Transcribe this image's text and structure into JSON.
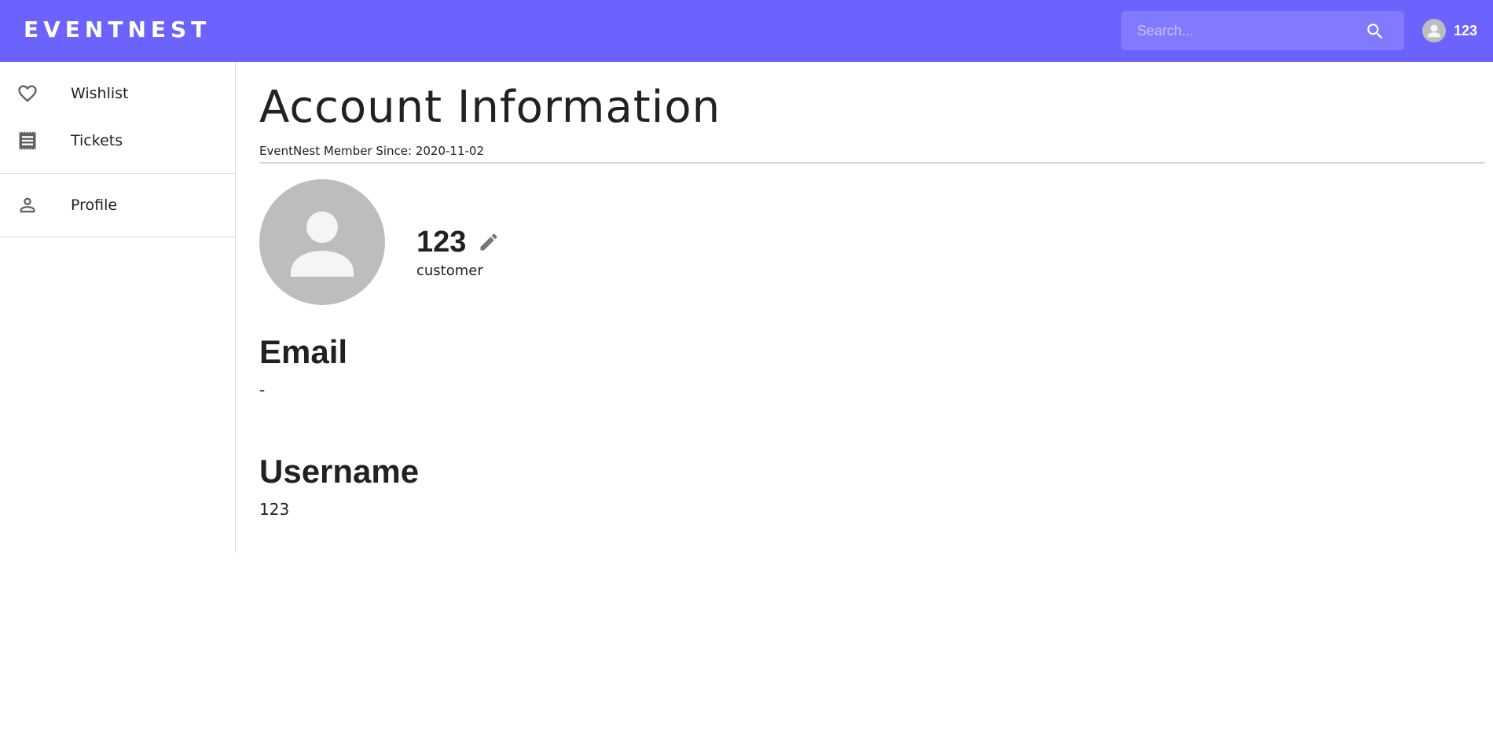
{
  "header": {
    "brand": "EVENTNEST",
    "search_placeholder": "Search...",
    "user_name": "123"
  },
  "sidebar": {
    "items": [
      {
        "label": "Wishlist",
        "icon": "heart-icon"
      },
      {
        "label": "Tickets",
        "icon": "receipt-icon"
      },
      {
        "label": "Profile",
        "icon": "person-icon"
      }
    ]
  },
  "main": {
    "title": "Account Information",
    "member_since": "EventNest Member Since: 2020-11-02",
    "display_name": "123",
    "role": "customer",
    "email_label": "Email",
    "email_value": "-",
    "username_label": "Username",
    "username_value": "123"
  },
  "colors": {
    "brand": "#6c63ff",
    "avatar_bg": "#bdbdbd",
    "text": "#212121"
  }
}
